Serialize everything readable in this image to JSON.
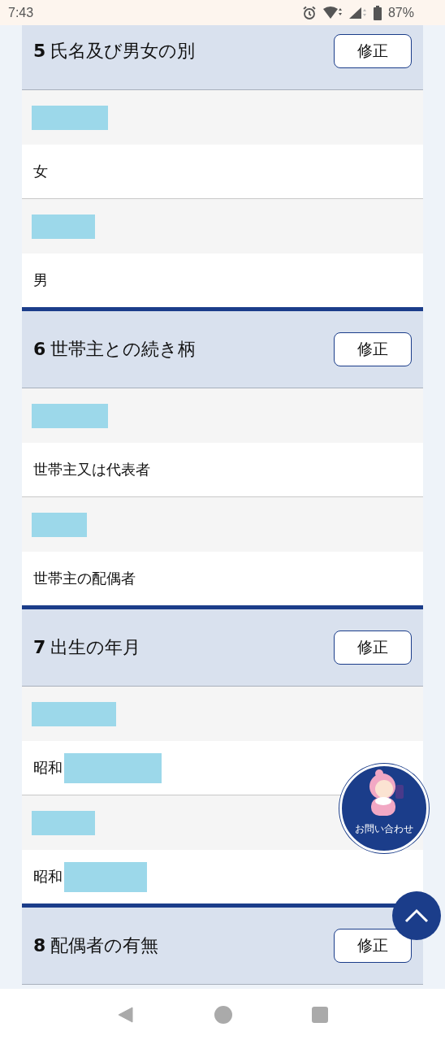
{
  "status_bar": {
    "time": "7:43",
    "battery": "87%"
  },
  "sections": [
    {
      "number": "5",
      "title": "氏名及び男女の別",
      "button": "修正",
      "rows": [
        {
          "value": "女",
          "redacted_suffix": false
        },
        {
          "value": "男",
          "redacted_suffix": false
        }
      ]
    },
    {
      "number": "6",
      "title": "世帯主との続き柄",
      "button": "修正",
      "rows": [
        {
          "value": "世帯主又は代表者",
          "redacted_suffix": false
        },
        {
          "value": "世帯主の配偶者",
          "redacted_suffix": false
        }
      ]
    },
    {
      "number": "7",
      "title": "出生の年月",
      "button": "修正",
      "rows": [
        {
          "value": "昭和",
          "redacted_suffix": true
        },
        {
          "value": "昭和",
          "redacted_suffix": true
        }
      ]
    },
    {
      "number": "8",
      "title": "配偶者の有無",
      "button": "修正"
    }
  ],
  "contact_button": {
    "label": "お問い合わせ"
  }
}
